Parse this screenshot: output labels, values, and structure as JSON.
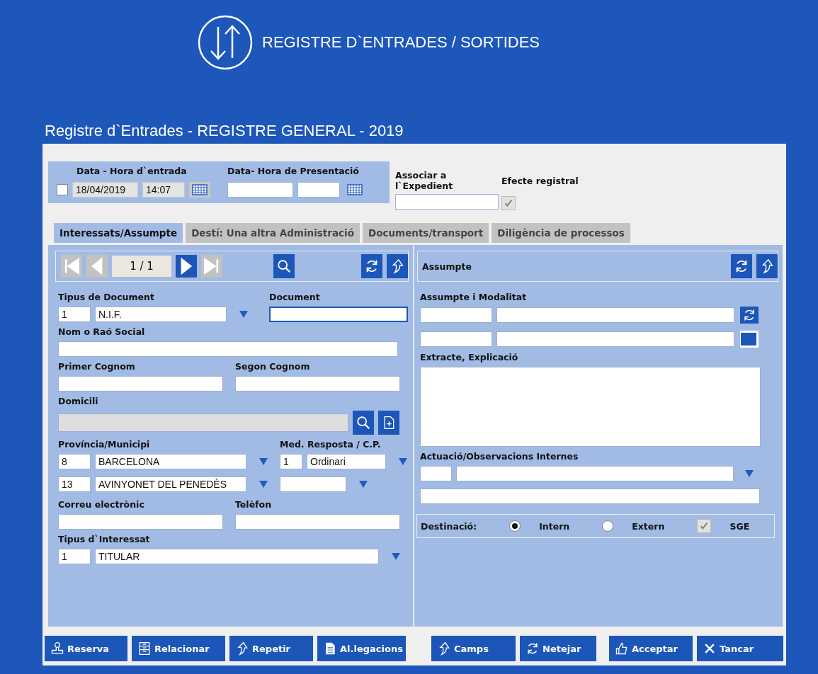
{
  "header": {
    "title": "REGISTRE D`ENTRADES / SORTIDES"
  },
  "form_title": "Registre d`Entrades - REGISTRE GENERAL - 2019",
  "entry": {
    "label": "Data - Hora d`entrada",
    "checked": false,
    "date": "18/04/2019",
    "time": "14:07"
  },
  "presentation": {
    "label": "Data- Hora de Presentació"
  },
  "expedient": {
    "label": "Associar a l`Expedient"
  },
  "efecte": {
    "label": "Efecte registral",
    "checked": true
  },
  "tabs": [
    {
      "label": "Interessats/Assumpte",
      "selected": true
    },
    {
      "label": "Destí: Una altra Administració",
      "selected": false
    },
    {
      "label": "Documents/transport",
      "selected": false
    },
    {
      "label": "Diligència de processos",
      "selected": false
    }
  ],
  "nav": {
    "counter": "1 / 1",
    "buttons": [
      {
        "kind": "first",
        "disabled": true
      },
      {
        "kind": "prev",
        "disabled": true
      },
      {
        "kind": "next",
        "disabled": false
      },
      {
        "kind": "last",
        "disabled": true
      }
    ]
  },
  "interessat": {
    "tipus_document": {
      "label": "Tipus de Document",
      "code": "1",
      "value": "N.I.F."
    },
    "document": {
      "label": "Document"
    },
    "nom": {
      "label": "Nom o Raó Social"
    },
    "primer_cognom": {
      "label": "Primer Cognom"
    },
    "segon_cognom": {
      "label": "Segon Cognom"
    },
    "domicili": {
      "label": "Domicili",
      "disabled": true
    },
    "provincia_municipi": {
      "label": "Província/Municipi",
      "rows": [
        {
          "code": "8",
          "value": "BARCELONA"
        },
        {
          "code": "13",
          "value": "AVINYONET DEL PENEDÈS"
        }
      ]
    },
    "med_resposta": {
      "label": "Med. Resposta / C.P.",
      "code": "1",
      "value": "Ordinari"
    },
    "correu": {
      "label": "Correu electrònic"
    },
    "telefon": {
      "label": "Telèfon"
    },
    "tipus_interessat": {
      "label": "Tipus d`Interessat",
      "code": "1",
      "value": "TITULAR"
    }
  },
  "assumpte": {
    "title": "Assumpte",
    "modalitat": {
      "label": "Assumpte i Modalitat"
    },
    "extracte": {
      "label": "Extracte, Explicació"
    },
    "actuacio": {
      "label": "Actuació/Observacions Internes"
    },
    "destinacio": {
      "label": "Destinació:",
      "options": [
        {
          "label": "Intern",
          "selected": true
        },
        {
          "label": "Extern",
          "selected": false
        }
      ],
      "sge": {
        "label": "SGE",
        "checked": true
      }
    }
  },
  "buttons": [
    {
      "label": "Reserva",
      "kind": "stamp"
    },
    {
      "label": "Relacionar",
      "kind": "list"
    },
    {
      "label": "Repetir",
      "kind": "arrow"
    },
    {
      "label": "Al.legacions",
      "kind": "doc"
    },
    {
      "label": "Camps",
      "kind": "arrow"
    },
    {
      "label": "Netejar",
      "kind": "refresh"
    },
    {
      "label": "Acceptar",
      "kind": "thumb"
    },
    {
      "label": "Tancar",
      "kind": "close"
    }
  ]
}
